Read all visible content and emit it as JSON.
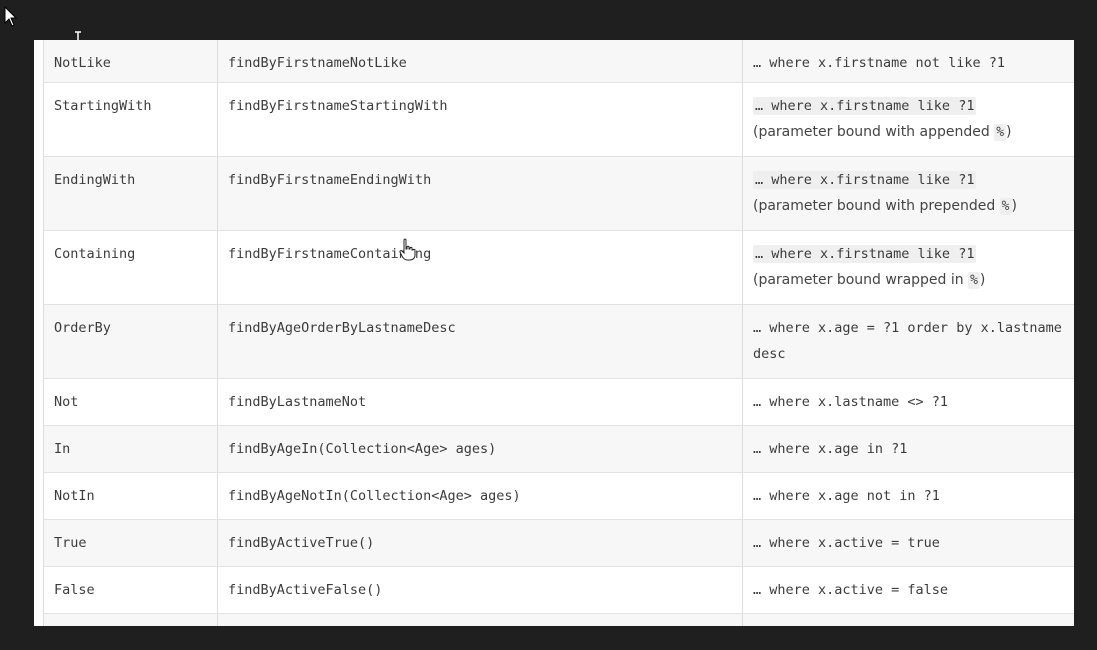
{
  "table": {
    "rows": [
      {
        "keyword": "NotLike",
        "sample": "findByFirstnameNotLike",
        "jpql": "… where x.firstname not like ?1",
        "note": null
      },
      {
        "keyword": "StartingWith",
        "sample": "findByFirstnameStartingWith",
        "jpql": "… where x.firstname like ?1",
        "note": {
          "before": "(parameter bound with appended ",
          "code": "%",
          "after": ")"
        }
      },
      {
        "keyword": "EndingWith",
        "sample": "findByFirstnameEndingWith",
        "jpql": "… where x.firstname like ?1",
        "note": {
          "before": "(parameter bound with prepended ",
          "code": "%",
          "after": ")"
        }
      },
      {
        "keyword": "Containing",
        "sample": "findByFirstnameContaining",
        "jpql": "… where x.firstname like ?1",
        "note": {
          "before": "(parameter bound wrapped in ",
          "code": "%",
          "after": ")"
        }
      },
      {
        "keyword": "OrderBy",
        "sample": "findByAgeOrderByLastnameDesc",
        "jpql": "… where x.age = ?1 order by x.lastname desc",
        "note": null
      },
      {
        "keyword": "Not",
        "sample": "findByLastnameNot",
        "jpql": "… where x.lastname <> ?1",
        "note": null
      },
      {
        "keyword": "In",
        "sample": "findByAgeIn(Collection<Age> ages)",
        "jpql": "… where x.age in ?1",
        "note": null
      },
      {
        "keyword": "NotIn",
        "sample": "findByAgeNotIn(Collection<Age> ages)",
        "jpql": "… where x.age not in ?1",
        "note": null
      },
      {
        "keyword": "True",
        "sample": "findByActiveTrue()",
        "jpql": "… where x.active = true",
        "note": null
      },
      {
        "keyword": "False",
        "sample": "findByActiveFalse()",
        "jpql": "… where x.active = false",
        "note": null
      }
    ]
  },
  "icons": {
    "arrow_cursor": "arrow-cursor-icon",
    "text_cursor": "text-cursor-icon",
    "hand_cursor": "hand-pointer-icon"
  },
  "colors": {
    "backdrop": "#1f1f1f",
    "stripe": "#f7f7f7",
    "border": "#dcdcdc",
    "text": "#3c3c3c"
  }
}
